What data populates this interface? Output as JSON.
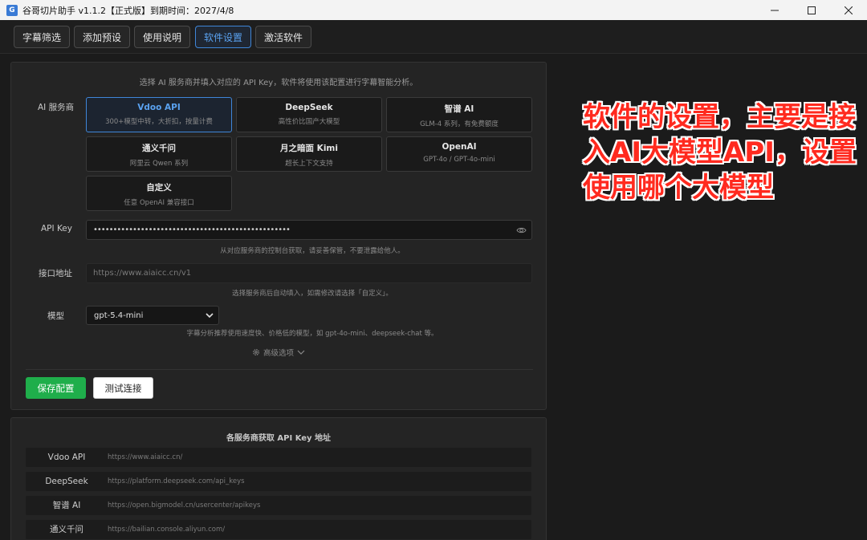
{
  "window": {
    "title": "谷哥切片助手 v1.1.2【正式版】到期时间：2027/4/8",
    "icon": "app-logo-icon",
    "minimize_icon": "minimize-icon",
    "maximize_icon": "maximize-icon",
    "close_icon": "close-icon"
  },
  "tabs": [
    {
      "label": "字幕筛选"
    },
    {
      "label": "添加预设"
    },
    {
      "label": "使用说明"
    },
    {
      "label": "软件设置",
      "active": true
    },
    {
      "label": "激活软件"
    }
  ],
  "settings": {
    "intro": "选择 AI 服务商并填入对应的 API Key，软件将使用该配置进行字幕智能分析。",
    "provider_label": "AI 服务商",
    "providers": [
      {
        "name": "Vdoo API",
        "desc": "300+模型中转，大折扣，按量计费",
        "selected": true
      },
      {
        "name": "DeepSeek",
        "desc": "高性价比国产大模型"
      },
      {
        "name": "智谱 AI",
        "desc": "GLM-4 系列，有免费额度"
      },
      {
        "name": "通义千问",
        "desc": "阿里云 Qwen 系列"
      },
      {
        "name": "月之暗面 Kimi",
        "desc": "超长上下文支持"
      },
      {
        "name": "OpenAI",
        "desc": "GPT-4o / GPT-4o-mini"
      },
      {
        "name": "自定义",
        "desc": "任意 OpenAI 兼容接口"
      }
    ],
    "api_key_label": "API Key",
    "api_key_value": "••••••••••••••••••••••••••••••••••••••••••••••••••",
    "api_key_hint": "从对应服务商的控制台获取，请妥善保管，不要泄露给他人。",
    "endpoint_label": "接口地址",
    "endpoint_value": "https://www.aiaicc.cn/v1",
    "endpoint_hint": "选择服务商后自动填入，如需修改请选择「自定义」。",
    "model_label": "模型",
    "model_value": "gpt-5.4-mini",
    "model_hint": "字幕分析推荐使用速度快、价格低的模型，如 gpt-4o-mini、deepseek-chat 等。",
    "advanced_label": "高级选项",
    "save_label": "保存配置",
    "test_label": "测试连接"
  },
  "links": {
    "title": "各服务商获取 API Key 地址",
    "rows": [
      {
        "name": "Vdoo API",
        "url": "https://www.aiaicc.cn/"
      },
      {
        "name": "DeepSeek",
        "url": "https://platform.deepseek.com/api_keys"
      },
      {
        "name": "智谱 AI",
        "url": "https://open.bigmodel.cn/usercenter/apikeys"
      },
      {
        "name": "通义千问",
        "url": "https://bailian.console.aliyun.com/"
      }
    ]
  },
  "annotation": {
    "line1": "软件的设置，主要是接",
    "line2": "入AI大模型API，设置",
    "line3": "使用哪个大模型"
  },
  "colors": {
    "accent": "#3f86d8",
    "save_green": "#1fae4b",
    "annotation_red": "#ff2a1f"
  }
}
